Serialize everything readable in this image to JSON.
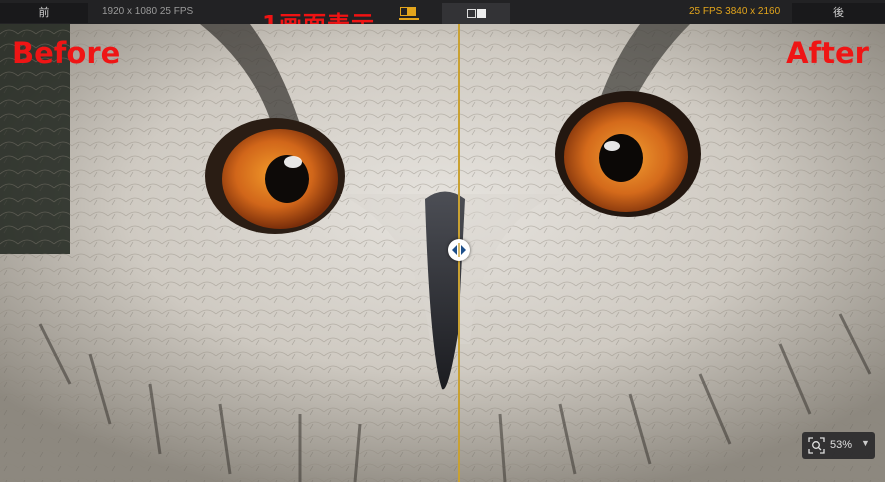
{
  "topbar": {
    "prev_label": "前",
    "next_label": "後",
    "before_info": "1920 x 1080  25 FPS",
    "after_info": "25 FPS  3840 x 2160",
    "active_mode": "single-view",
    "accent_color": "#e3a51c"
  },
  "annotations": {
    "mode_label": "1画面表示",
    "before_label": "Before",
    "after_label": "After",
    "color": "#ef1515"
  },
  "viewer": {
    "image_subject": "owl-face-closeup",
    "zoom_percent": "53%",
    "divider_handle_icon": "split-arrows-icon",
    "zoom_icon": "zoom-fit-icon",
    "dropdown_icon": "chevron-down-icon"
  }
}
